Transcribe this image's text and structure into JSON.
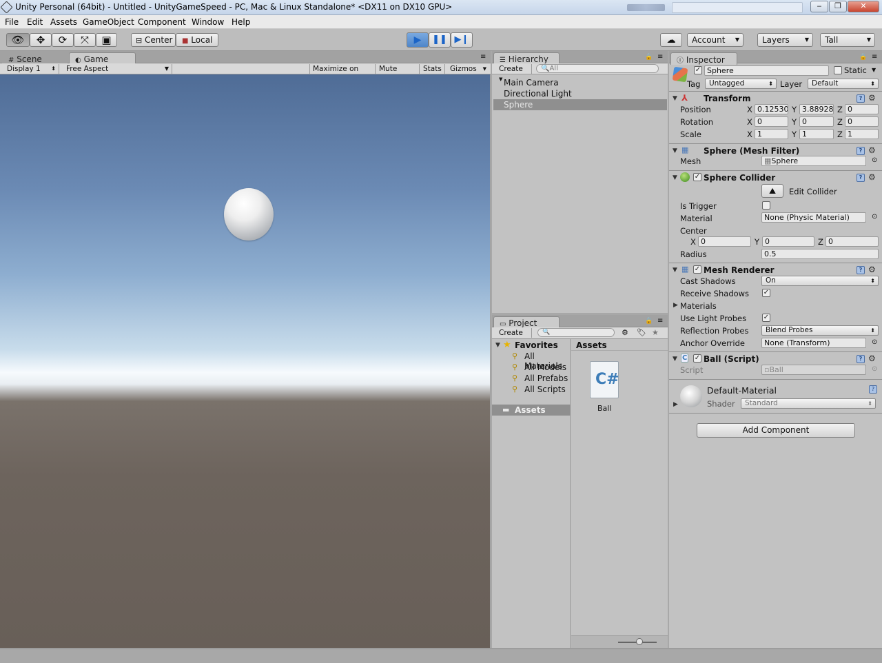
{
  "window": {
    "title": "Unity Personal (64bit) - Untitled - UnityGameSpeed - PC, Mac & Linux Standalone* <DX11 on DX10 GPU>"
  },
  "menu": [
    "File",
    "Edit",
    "Assets",
    "GameObject",
    "Component",
    "Window",
    "Help"
  ],
  "toolbar": {
    "center_label": "Center",
    "local_label": "Local",
    "account_label": "Account",
    "layers_label": "Layers",
    "layout_label": "Tall"
  },
  "game_panel": {
    "tab_scene": "Scene",
    "tab_game": "Game",
    "display": "Display 1",
    "aspect": "Free Aspect",
    "maximize": "Maximize on Play",
    "mute": "Mute audio",
    "stats": "Stats",
    "gizmos": "Gizmos"
  },
  "hierarchy": {
    "tab": "Hierarchy",
    "create": "Create",
    "search_placeholder": "All",
    "items": [
      "Main Camera",
      "Directional Light",
      "Sphere"
    ]
  },
  "project": {
    "tab": "Project",
    "create": "Create",
    "favorites": "Favorites",
    "fav_items": [
      "All Materials",
      "All Models",
      "All Prefabs",
      "All Scripts"
    ],
    "assets_folder": "Assets",
    "assets_header": "Assets",
    "asset_item": "Ball",
    "asset_glyph": "C#"
  },
  "inspector": {
    "tab": "Inspector",
    "object_name": "Sphere",
    "static_label": "Static",
    "tag_label": "Tag",
    "tag_value": "Untagged",
    "layer_label": "Layer",
    "layer_value": "Default",
    "transform": {
      "title": "Transform",
      "position_label": "Position",
      "rotation_label": "Rotation",
      "scale_label": "Scale",
      "pos": {
        "x": "0.12530",
        "y": "3.88928",
        "z": "0"
      },
      "rot": {
        "x": "0",
        "y": "0",
        "z": "0"
      },
      "scale": {
        "x": "1",
        "y": "1",
        "z": "1"
      }
    },
    "mesh_filter": {
      "title": "Sphere (Mesh Filter)",
      "mesh_label": "Mesh",
      "mesh_value": "Sphere"
    },
    "collider": {
      "title": "Sphere Collider",
      "edit_label": "Edit Collider",
      "is_trigger": "Is Trigger",
      "material_label": "Material",
      "material_value": "None (Physic Material)",
      "center_label": "Center",
      "center": {
        "x": "0",
        "y": "0",
        "z": "0"
      },
      "radius_label": "Radius",
      "radius_value": "0.5"
    },
    "renderer": {
      "title": "Mesh Renderer",
      "cast_label": "Cast Shadows",
      "cast_value": "On",
      "receive_label": "Receive Shadows",
      "materials_label": "Materials",
      "probes_label": "Use Light Probes",
      "reflection_label": "Reflection Probes",
      "reflection_value": "Blend Probes",
      "anchor_label": "Anchor Override",
      "anchor_value": "None (Transform)"
    },
    "script": {
      "title": "Ball (Script)",
      "script_label": "Script",
      "script_value": "Ball"
    },
    "material": {
      "name": "Default-Material",
      "shader_label": "Shader",
      "shader_value": "Standard"
    },
    "add_component": "Add Component",
    "axis_x": "X",
    "axis_y": "Y",
    "axis_z": "Z"
  }
}
